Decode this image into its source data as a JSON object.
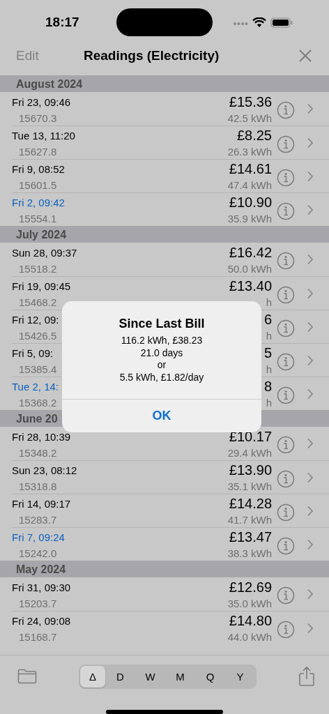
{
  "status_bar": {
    "time": "18:17"
  },
  "nav": {
    "left": "Edit",
    "title": "Readings (Electricity)"
  },
  "sections": [
    {
      "title": "August 2024",
      "rows": [
        {
          "date": "Fri 23, 09:46",
          "reading": "15670.3",
          "cost": "£15.36",
          "usage": "42.5 kWh",
          "bill": false
        },
        {
          "date": "Tue 13, 11:20",
          "reading": "15627.8",
          "cost": "£8.25",
          "usage": "26.3 kWh",
          "bill": false
        },
        {
          "date": "Fri 9, 08:52",
          "reading": "15601.5",
          "cost": "£14.61",
          "usage": "47.4 kWh",
          "bill": false
        },
        {
          "date": "Fri 2, 09:42",
          "reading": "15554.1",
          "cost": "£10.90",
          "usage": "35.9 kWh",
          "bill": true
        }
      ]
    },
    {
      "title": "July 2024",
      "rows": [
        {
          "date": "Sun 28, 09:37",
          "reading": "15518.2",
          "cost": "£16.42",
          "usage": "50.0 kWh",
          "bill": false
        },
        {
          "date": "Fri 19, 09:45",
          "reading": "15468.2",
          "cost": "£13.40",
          "usage": "h",
          "bill": false
        },
        {
          "date": "Fri 12, 09:",
          "reading": "15426.5",
          "cost": "6",
          "usage": "h",
          "bill": false
        },
        {
          "date": "Fri 5, 09:",
          "reading": "15385.4",
          "cost": "5",
          "usage": "h",
          "bill": false
        },
        {
          "date": "Tue 2, 14:",
          "reading": "15368.2",
          "cost": "8",
          "usage": "h",
          "bill": true
        }
      ]
    },
    {
      "title": "June 20",
      "rows": [
        {
          "date": "Fri 28, 10:39",
          "reading": "15348.2",
          "cost": "£10.17",
          "usage": "29.4 kWh",
          "bill": false
        },
        {
          "date": "Sun 23, 08:12",
          "reading": "15318.8",
          "cost": "£13.90",
          "usage": "35.1 kWh",
          "bill": false
        },
        {
          "date": "Fri 14, 09:17",
          "reading": "15283.7",
          "cost": "£14.28",
          "usage": "41.7 kWh",
          "bill": false
        },
        {
          "date": "Fri 7, 09:24",
          "reading": "15242.0",
          "cost": "£13.47",
          "usage": "38.3 kWh",
          "bill": true
        }
      ]
    },
    {
      "title": "May 2024",
      "rows": [
        {
          "date": "Fri 31, 09:30",
          "reading": "15203.7",
          "cost": "£12.69",
          "usage": "35.0 kWh",
          "bill": false
        },
        {
          "date": "Fri 24, 09:08",
          "reading": "15168.7",
          "cost": "£14.80",
          "usage": "44.0 kWh",
          "bill": false
        }
      ]
    }
  ],
  "segments": [
    {
      "label": "Δ",
      "selected": true
    },
    {
      "label": "D",
      "selected": false
    },
    {
      "label": "W",
      "selected": false
    },
    {
      "label": "M",
      "selected": false
    },
    {
      "label": "Q",
      "selected": false
    },
    {
      "label": "Y",
      "selected": false
    }
  ],
  "alert": {
    "title": "Since Last Bill",
    "lines": [
      "116.2 kWh, £38.23",
      "21.0 days",
      "or",
      "5.5 kWh, £1.82/day"
    ],
    "button": "OK"
  }
}
